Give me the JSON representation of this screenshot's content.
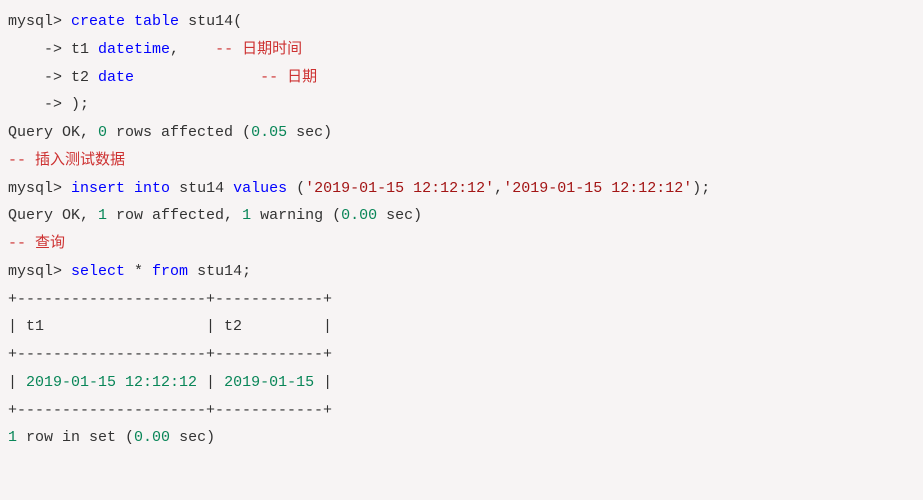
{
  "lines": {
    "l1_prompt": "mysql> ",
    "l1_kw1": "create",
    "l1_kw2": "table",
    "l1_ident": "stu14",
    "l1_p": "(",
    "l2_cont": "    -> ",
    "l2_col": "t1 ",
    "l2_type": "datetime",
    "l2_comma": ",    ",
    "l2_comment": "-- 日期时间",
    "l3_cont": "    -> ",
    "l3_col": "t2 ",
    "l3_type": "date",
    "l3_pad": "              ",
    "l3_comment": "-- 日期",
    "l4_cont": "    -> ",
    "l4_close": ");",
    "l5_result": "Query OK, ",
    "l5_n0": "0",
    "l5_mid": " rows affected (",
    "l5_n1": "0.05",
    "l5_end": " sec)",
    "l6_comment": "-- 插入测试数据",
    "l7_prompt": "mysql> ",
    "l7_kw1": "insert",
    "l7_kw2": "into",
    "l7_ident": "stu14",
    "l7_kw3": "values",
    "l7_p1": " (",
    "l7_str1": "'2019-01-15 12:12:12'",
    "l7_comma": ",",
    "l7_str2": "'2019-01-15 12:12:12'",
    "l7_p2": ");",
    "l8_result": "Query OK, ",
    "l8_n1": "1",
    "l8_mid": " row affected, ",
    "l8_n2": "1",
    "l8_warn": " warning (",
    "l8_n3": "0.00",
    "l8_end": " sec)",
    "l9_comment": "-- 查询",
    "l10_prompt": "mysql> ",
    "l10_kw1": "select",
    "l10_star": " * ",
    "l10_kw2": "from",
    "l10_ident": " stu14",
    "l10_semi": ";",
    "table_border": "+---------------------+------------+",
    "table_header": "| t1                  | t2         |",
    "table_row": "| 2019-01-15 12:12:12 | 2019-01-15 |",
    "l15_n1": "1",
    "l15_mid": " row in set (",
    "l15_n2": "0.00",
    "l15_end": " sec)"
  }
}
